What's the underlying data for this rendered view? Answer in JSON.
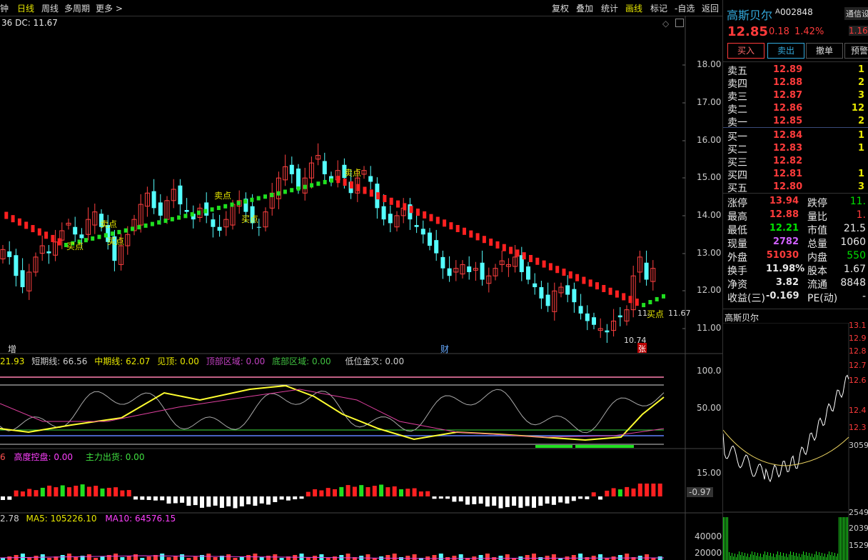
{
  "toolbar": {
    "left_items": [
      "钟",
      "日线",
      "周线",
      "多周期",
      "更多 >"
    ],
    "right_items": [
      "复权",
      "叠加",
      "统计",
      "画线",
      "标记",
      "-自选",
      "返回"
    ]
  },
  "main_chart": {
    "indicator_label": "36  DC: 11.67",
    "price_axis": [
      "18.00",
      "17.00",
      "16.00",
      "15.00",
      "14.00",
      "13.00",
      "12.00",
      "11.00"
    ],
    "annotations": [
      {
        "text": "买点",
        "color": "#e8e800"
      },
      {
        "text": "买点",
        "color": "#e8e800"
      },
      {
        "text": "卖点",
        "color": "#e8e800"
      },
      {
        "text": "卖点",
        "color": "#e8e800"
      },
      {
        "text": "买点",
        "color": "#e8e800"
      },
      {
        "text": "卖点",
        "color": "#e8e800"
      },
      {
        "text": "买点",
        "color": "#e8e800"
      }
    ],
    "low_label": "10.74",
    "last_label": "11.67",
    "mid_label": "11.",
    "bottom_tags": [
      "增",
      "财",
      "张"
    ]
  },
  "osc": {
    "legend": [
      {
        "text": "21.93",
        "color": "#e8e800"
      },
      {
        "text": "短期线: 66.56",
        "color": "#cfcfcf"
      },
      {
        "text": "中期线: 62.07",
        "color": "#e8e800"
      },
      {
        "text": "见顶: 0.00",
        "color": "#e8e800"
      },
      {
        "text": "顶部区域: 0.00",
        "color": "#c040c0"
      },
      {
        "text": "底部区域: 0.00",
        "color": "#40c040"
      },
      {
        "text": "低位金叉: 0.00",
        "color": "#cfcfcf"
      }
    ],
    "axis": [
      "100.0",
      "50.00"
    ]
  },
  "flow": {
    "legend": [
      {
        "text": "6",
        "color": "#ff5050"
      },
      {
        "text": "高度控盘: 0.00",
        "color": "#ff40ff"
      },
      {
        "text": "主力出货: 0.00",
        "color": "#40e040"
      }
    ],
    "axis": [
      "15.00",
      "-0.97"
    ]
  },
  "vol": {
    "legend": [
      {
        "text": "2.78",
        "color": "#cfcfcf"
      },
      {
        "text": "MA5: 105226.10",
        "color": "#e8e800"
      },
      {
        "text": "MA10: 64576.15",
        "color": "#ff40ff"
      }
    ],
    "axis": [
      "40000",
      "20000"
    ]
  },
  "stock": {
    "name": "高斯贝尔",
    "code": "002848",
    "badge": "通信设",
    "price": "12.85",
    "change": "0.18",
    "pct": "1.42%",
    "side_price": "1.16"
  },
  "buttons": [
    "买入",
    "卖出",
    "撤单",
    "预警"
  ],
  "asks": [
    {
      "label": "卖五",
      "price": "12.89",
      "vol": "1"
    },
    {
      "label": "卖四",
      "price": "12.88",
      "vol": "2"
    },
    {
      "label": "卖三",
      "price": "12.87",
      "vol": "3"
    },
    {
      "label": "卖二",
      "price": "12.86",
      "vol": "12"
    },
    {
      "label": "卖一",
      "price": "12.85",
      "vol": "2"
    }
  ],
  "bids": [
    {
      "label": "买一",
      "price": "12.84",
      "vol": "1"
    },
    {
      "label": "买二",
      "price": "12.83",
      "vol": "1"
    },
    {
      "label": "买三",
      "price": "12.82",
      "vol": ""
    },
    {
      "label": "买四",
      "price": "12.81",
      "vol": "1"
    },
    {
      "label": "买五",
      "price": "12.80",
      "vol": "3"
    }
  ],
  "stats": [
    {
      "l1": "涨停",
      "v1": "13.94",
      "c1": "#ff3b3b",
      "l2": "跌停",
      "v2": "11.",
      "c2": "#00e000"
    },
    {
      "l1": "最高",
      "v1": "12.88",
      "c1": "#ff3b3b",
      "l2": "量比",
      "v2": "1.",
      "c2": "#ff3b3b"
    },
    {
      "l1": "最低",
      "v1": "12.21",
      "c1": "#00e000",
      "l2": "市值",
      "v2": "21.5",
      "c2": "#e8e8e8"
    },
    {
      "l1": "现量",
      "v1": "2782",
      "c1": "#d060ff",
      "l2": "总量",
      "v2": "1060",
      "c2": "#e8e8e8"
    },
    {
      "l1": "外盘",
      "v1": "51030",
      "c1": "#ff3b3b",
      "l2": "内盘",
      "v2": "550",
      "c2": "#00e000"
    },
    {
      "l1": "换手",
      "v1": "11.98%",
      "c1": "#e8e8e8",
      "l2": "股本",
      "v2": "1.67",
      "c2": "#e8e8e8"
    },
    {
      "l1": "净资",
      "v1": "3.82",
      "c1": "#e8e8e8",
      "l2": "流通",
      "v2": "8848",
      "c2": "#e8e8e8"
    },
    {
      "l1": "收益(三)",
      "v1": "-0.169",
      "c1": "#e8e8e8",
      "l2": "PE(动)",
      "v2": "-",
      "c2": "#e8e8e8"
    }
  ],
  "minichart": {
    "title": "高斯贝尔",
    "axis": [
      "13.1",
      "12.9",
      "12.8",
      "12.7",
      "12.6",
      "12.4",
      "12.3",
      "3059"
    ],
    "vol_axis": [
      "2549",
      "2039",
      "1529"
    ]
  }
}
